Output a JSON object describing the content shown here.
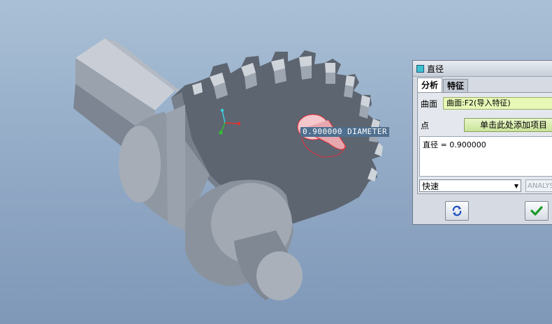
{
  "viewport": {
    "dimension_callout": "0.900000 DIAMETER"
  },
  "dialog": {
    "title": "直径",
    "tabs": [
      {
        "label": "分析",
        "active": true
      },
      {
        "label": "特征",
        "active": false
      }
    ],
    "surface_label": "曲面",
    "surface_value": "曲面:F2(导入特征)",
    "point_label": "点",
    "point_button": "单击此处添加项目",
    "result_text": "直径 = 0.900000",
    "mode_value": "快速",
    "analysis_name": "ANALYSIS",
    "refresh_icon": "refresh-icon",
    "confirm_icon": "check-icon"
  },
  "colors": {
    "background_top": "#a9c0d6",
    "model_gray": "#7b8592",
    "highlight_red": "#e8303a",
    "field_green": "#e6f7b6",
    "confirm_green": "#1a9a2a"
  }
}
